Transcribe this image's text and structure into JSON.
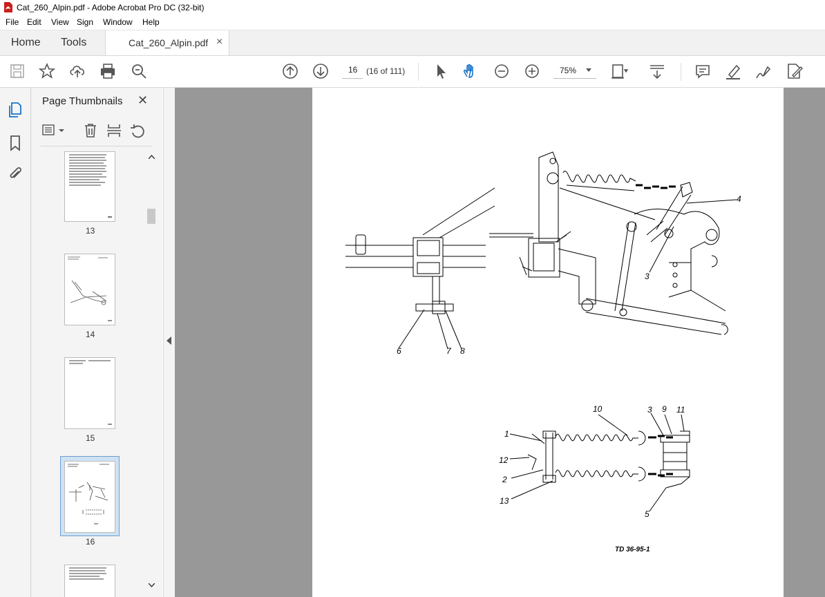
{
  "window": {
    "title": "Cat_260_Alpin.pdf - Adobe Acrobat Pro DC (32-bit)"
  },
  "menu": [
    "File",
    "Edit",
    "View",
    "Sign",
    "Window",
    "Help"
  ],
  "tabs": {
    "home": "Home",
    "tools": "Tools",
    "document": "Cat_260_Alpin.pdf",
    "close": "×"
  },
  "toolbar": {
    "page_input": "16",
    "page_count": "(16 of 111)",
    "zoom": "75%",
    "icons": [
      "save-icon",
      "star-icon",
      "upload-icon",
      "print-icon",
      "search-zoom-icon",
      "page-up-icon",
      "page-down-icon",
      "select-cursor-icon",
      "hand-icon",
      "zoom-out-icon",
      "zoom-in-icon",
      "zoom-dropdown-icon",
      "page-fit-icon",
      "scroll-mode-icon",
      "comment-icon",
      "highlight-icon",
      "sign-icon",
      "edit-icon"
    ]
  },
  "sidebar": {
    "panel_title": "Page Thumbnails",
    "close": "✕",
    "thumbnails": [
      {
        "label": "13"
      },
      {
        "label": "14"
      },
      {
        "label": "15"
      },
      {
        "label": "16",
        "selected": true
      }
    ]
  },
  "drawing": {
    "callouts": [
      "1",
      "2",
      "3",
      "4",
      "5",
      "6",
      "7",
      "8",
      "9",
      "10",
      "11",
      "12",
      "13",
      "3"
    ],
    "reference": "TD 36-95-1"
  },
  "colors": {
    "accent": "#1a73c9",
    "viewer_bg": "#989898",
    "panel_bg": "#f4f4f4"
  }
}
